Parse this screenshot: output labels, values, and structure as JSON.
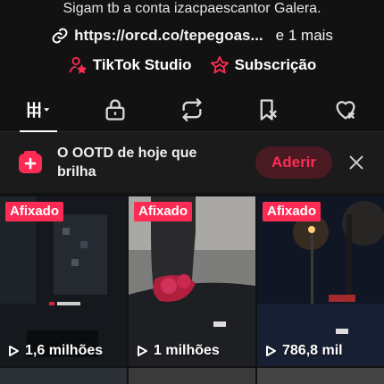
{
  "profile": {
    "bio": "Sigam tb a conta izacpaescantor Galera.",
    "link": "https://orcd.co/tepegoas...",
    "more_links": "e 1 mais"
  },
  "tools": {
    "studio_label": "TikTok Studio",
    "subscription_label": "Subscrição"
  },
  "tabs": [
    {
      "name": "videos",
      "icon": "grid-icon",
      "active": true
    },
    {
      "name": "private",
      "icon": "lock-icon"
    },
    {
      "name": "reposts",
      "icon": "repost-icon"
    },
    {
      "name": "favorites",
      "icon": "bookmark-icon"
    },
    {
      "name": "liked",
      "icon": "heart-icon"
    }
  ],
  "banner": {
    "text": "O OOTD de hoje que brilha",
    "join_label": "Aderir"
  },
  "videos": [
    {
      "pinned_label": "Afixado",
      "views": "1,6 milhões"
    },
    {
      "pinned_label": "Afixado",
      "views": "1 milhões"
    },
    {
      "pinned_label": "Afixado",
      "views": "786,8 mil"
    }
  ],
  "colors": {
    "accent": "#fe2c55",
    "background": "#121212"
  }
}
